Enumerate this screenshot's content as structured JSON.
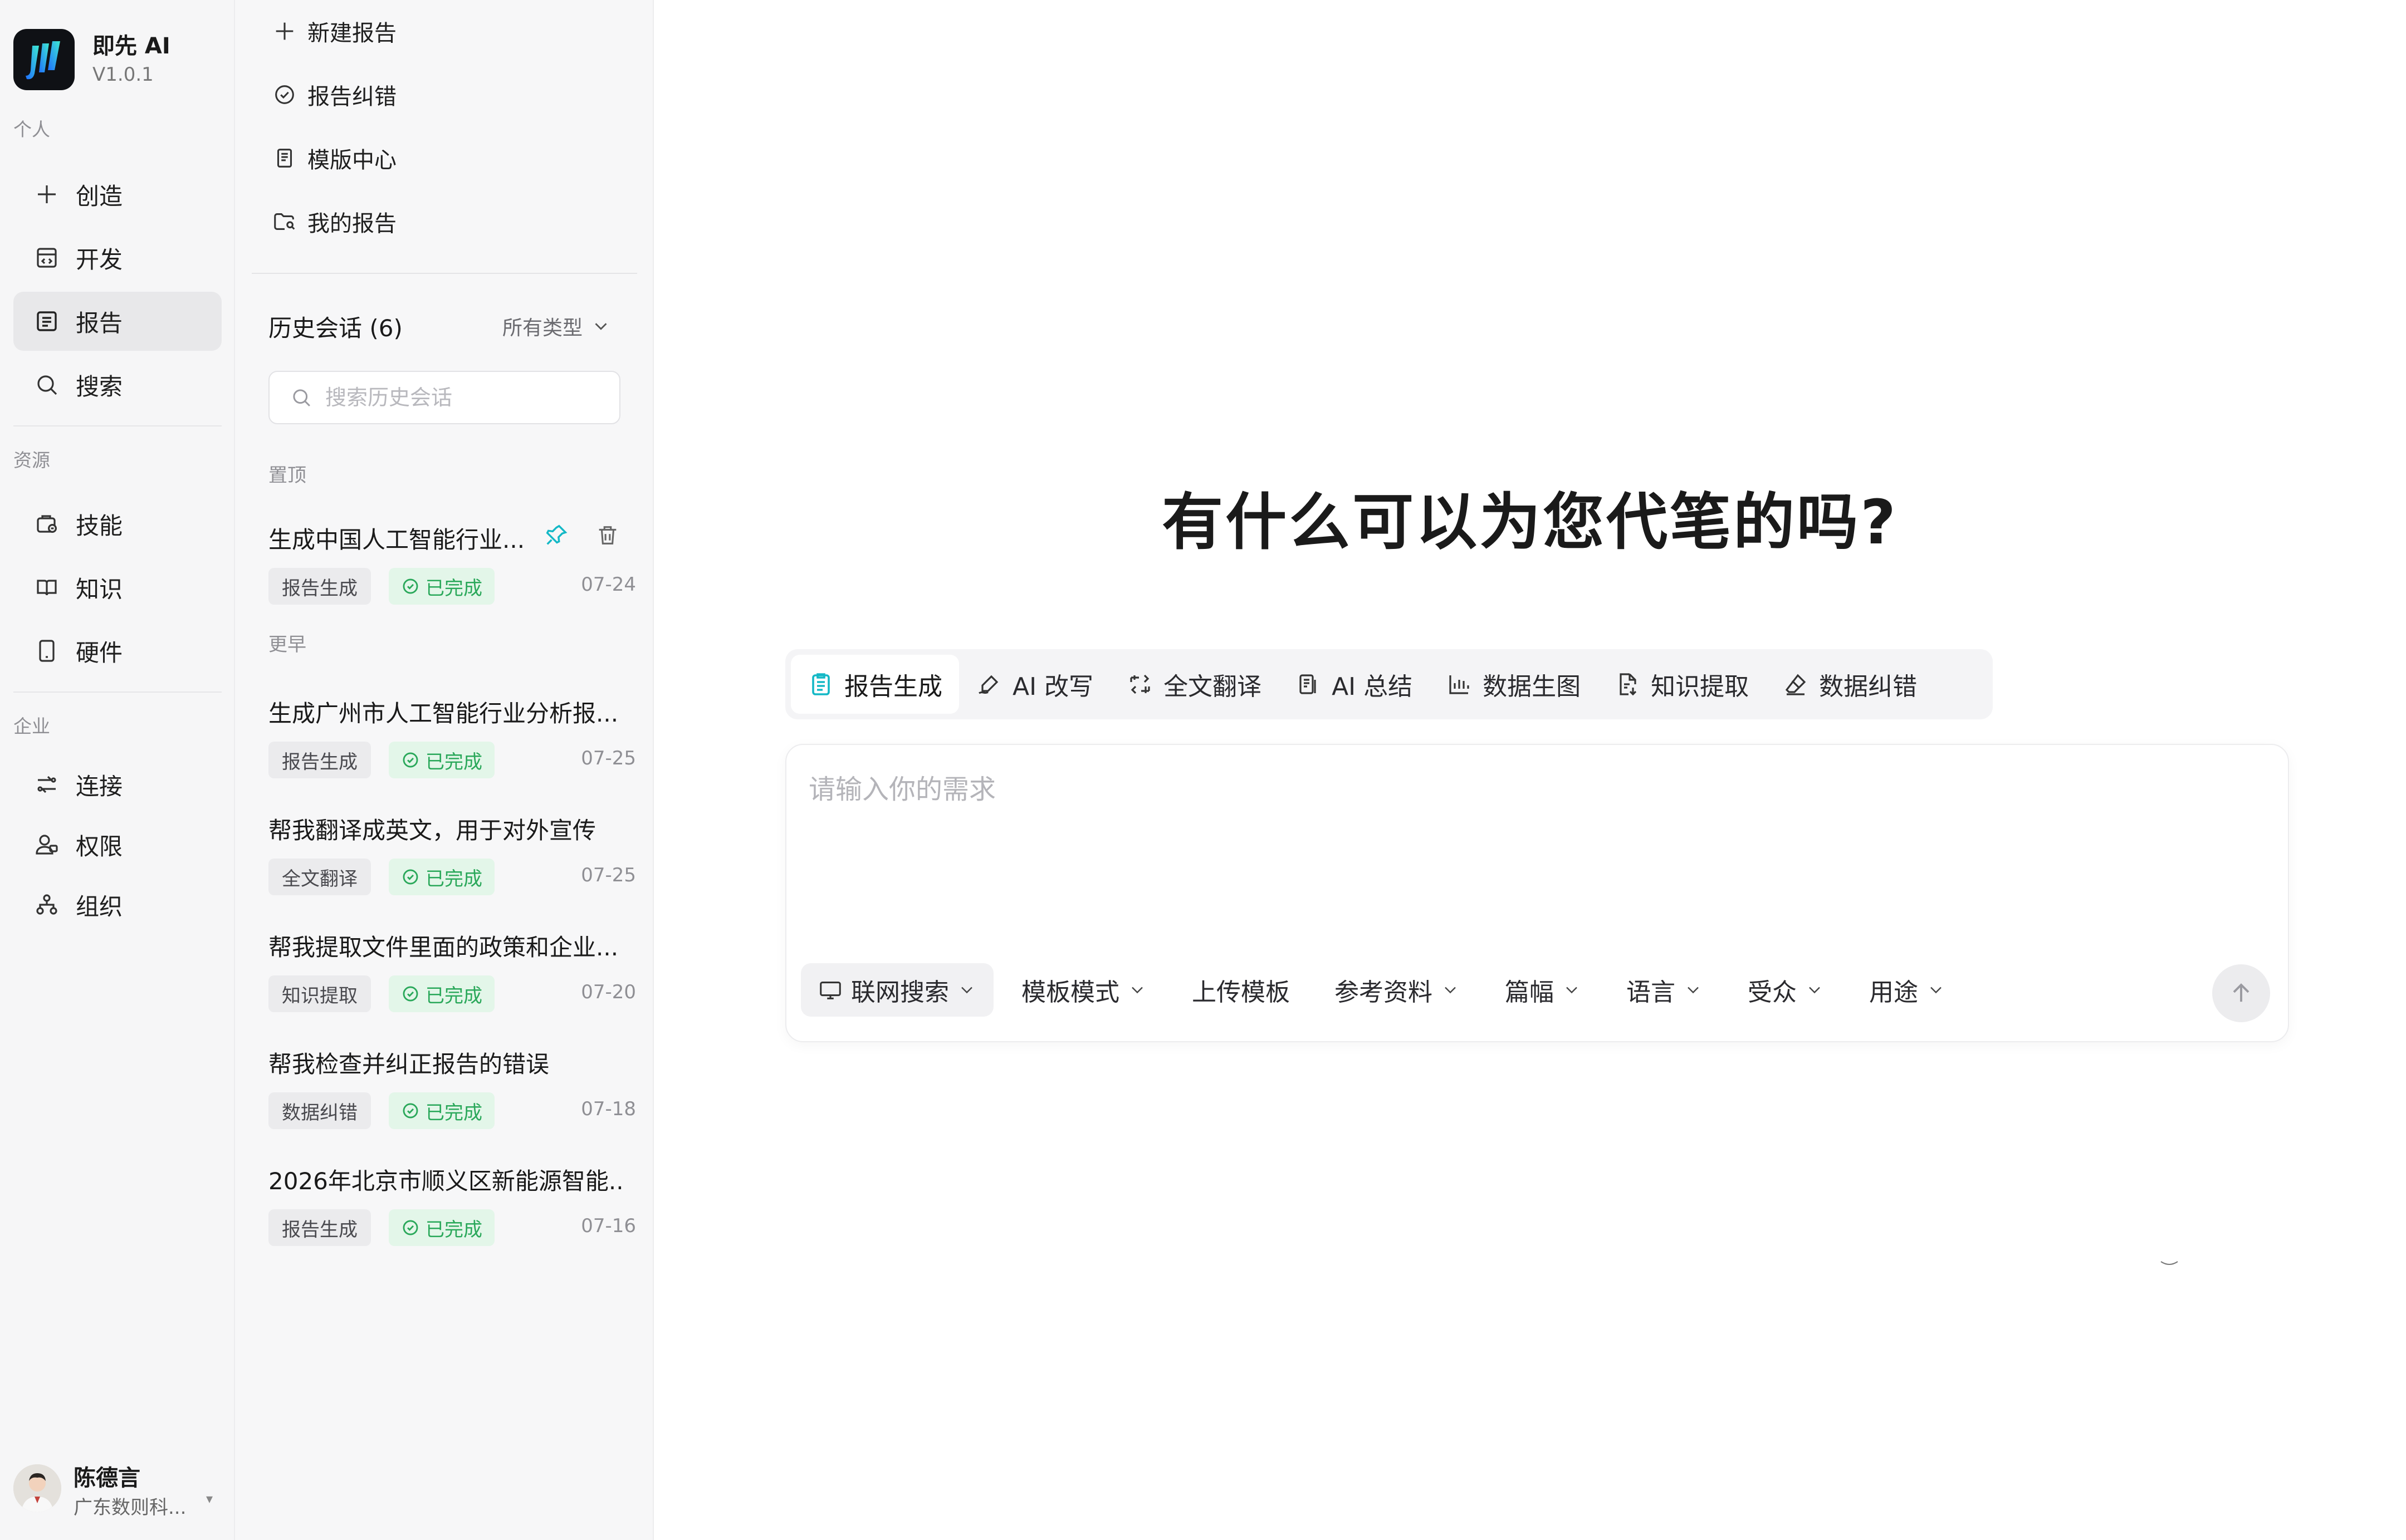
{
  "app": {
    "name": "即先 AI",
    "version": "V1.0.1"
  },
  "sidebar": {
    "sections": {
      "personal": "个人",
      "resources": "资源",
      "enterprise": "企业"
    },
    "items": [
      {
        "label": "创造",
        "icon": "plus-icon"
      },
      {
        "label": "开发",
        "icon": "code-window-icon"
      },
      {
        "label": "报告",
        "icon": "document-icon",
        "active": true
      },
      {
        "label": "搜索",
        "icon": "search-icon"
      },
      {
        "label": "技能",
        "icon": "skill-icon"
      },
      {
        "label": "知识",
        "icon": "book-icon"
      },
      {
        "label": "硬件",
        "icon": "device-icon"
      },
      {
        "label": "连接",
        "icon": "connect-icon"
      },
      {
        "label": "权限",
        "icon": "permission-icon"
      },
      {
        "label": "组织",
        "icon": "org-icon"
      }
    ]
  },
  "user": {
    "name": "陈德言",
    "org": "广东数则科..."
  },
  "report_actions": [
    {
      "label": "新建报告",
      "icon": "plus-icon"
    },
    {
      "label": "报告纠错",
      "icon": "check-circle-icon"
    },
    {
      "label": "模版中心",
      "icon": "template-icon"
    },
    {
      "label": "我的报告",
      "icon": "folder-icon"
    }
  ],
  "history": {
    "title": "历史会话 (6)",
    "filter": "所有类型",
    "search_placeholder": "搜索历史会话",
    "group_pinned": "置顶",
    "group_earlier": "更早",
    "status_label": "已完成",
    "items": [
      {
        "title": "生成中国人工智能行业...",
        "type": "报告生成",
        "date": "07-24",
        "pinned": true
      },
      {
        "title": "生成广州市人工智能行业分析报...",
        "type": "报告生成",
        "date": "07-25"
      },
      {
        "title": "帮我翻译成英文，用于对外宣传",
        "type": "全文翻译",
        "date": "07-25"
      },
      {
        "title": "帮我提取文件里面的政策和企业...",
        "type": "知识提取",
        "date": "07-20"
      },
      {
        "title": "帮我检查并纠正报告的错误",
        "type": "数据纠错",
        "date": "07-18"
      },
      {
        "title": "2026年北京市顺义区新能源智能...",
        "type": "报告生成",
        "date": "07-16"
      }
    ]
  },
  "main": {
    "headline": "有什么可以为您代笔的吗?",
    "tabs": [
      {
        "label": "报告生成",
        "icon": "report-icon"
      },
      {
        "label": "AI 改写",
        "icon": "rewrite-icon"
      },
      {
        "label": "全文翻译",
        "icon": "translate-icon"
      },
      {
        "label": "AI 总结",
        "icon": "summary-icon"
      },
      {
        "label": "数据生图",
        "icon": "chart-icon"
      },
      {
        "label": "知识提取",
        "icon": "extract-icon"
      },
      {
        "label": "数据纠错",
        "icon": "eraser-icon"
      }
    ],
    "input_placeholder": "请输入你的需求",
    "options": [
      {
        "label": "联网搜索",
        "icon": "monitor-icon"
      },
      {
        "label": "模板模式"
      },
      {
        "label": "上传模板"
      },
      {
        "label": "参考资料"
      },
      {
        "label": "篇幅"
      },
      {
        "label": "语言"
      },
      {
        "label": "受众"
      },
      {
        "label": "用途"
      }
    ]
  },
  "colors": {
    "accent": "#14b8c6",
    "success": "#2aa85a",
    "success_bg": "#e3f6e9"
  }
}
